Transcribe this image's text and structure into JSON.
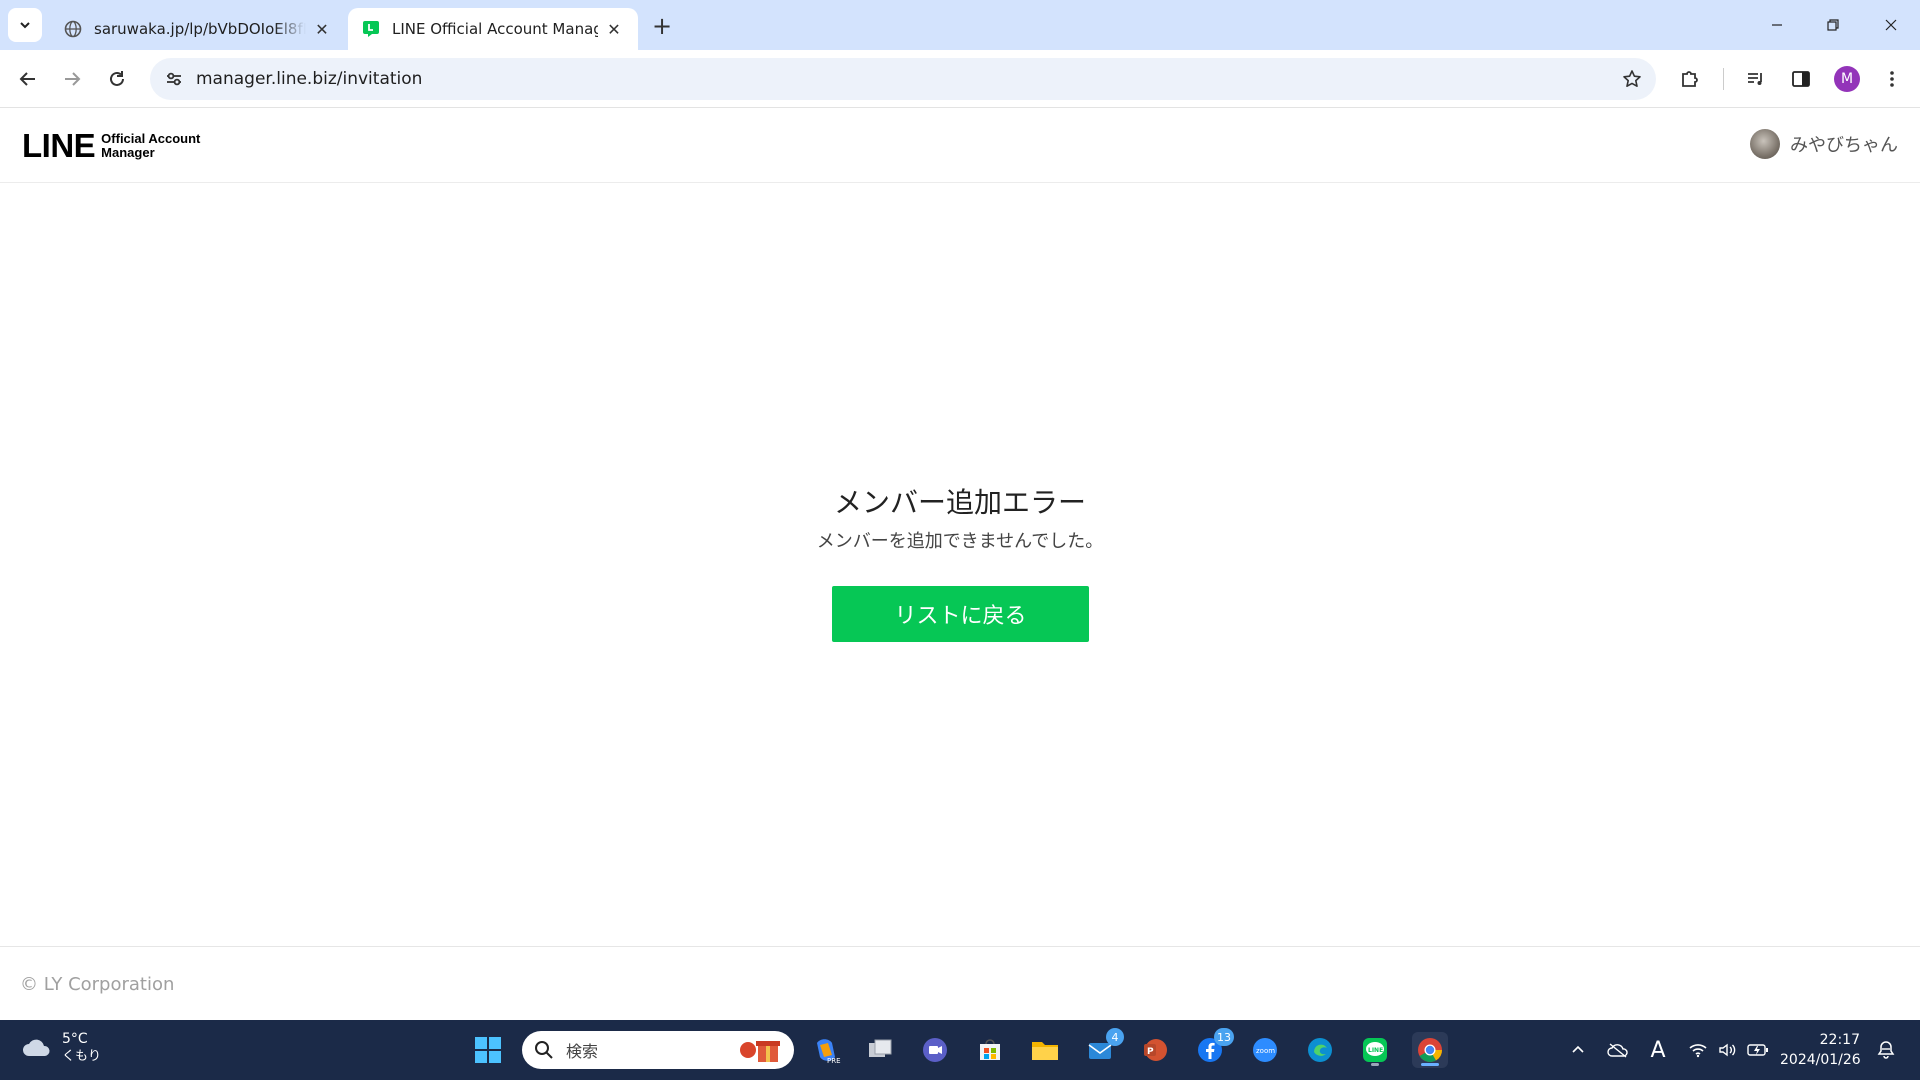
{
  "browser": {
    "tabs": [
      {
        "title": "saruwaka.jp/lp/bVbDOIoEl8fBs[",
        "active": false
      },
      {
        "title": "LINE Official Account Manager",
        "active": true
      }
    ],
    "url": "manager.line.biz/invitation",
    "profile_initial": "M"
  },
  "header": {
    "logo_main": "LINE",
    "logo_sub_line1": "Official Account",
    "logo_sub_line2": "Manager",
    "user_name": "みやびちゃん"
  },
  "error": {
    "title": "メンバー追加エラー",
    "message": "メンバーを追加できませんでした。",
    "back_button": "リストに戻る"
  },
  "footer": {
    "copyright": "© LY Corporation"
  },
  "taskbar": {
    "weather_temp": "5°C",
    "weather_condition": "くもり",
    "search_placeholder": "検索",
    "mail_badge": "4",
    "app_badge": "13",
    "time": "22:17",
    "date": "2024/01/26"
  },
  "colors": {
    "line_green": "#06c755",
    "tabstrip_bg": "#d3e3fd",
    "taskbar_bg": "#1b2a48"
  }
}
